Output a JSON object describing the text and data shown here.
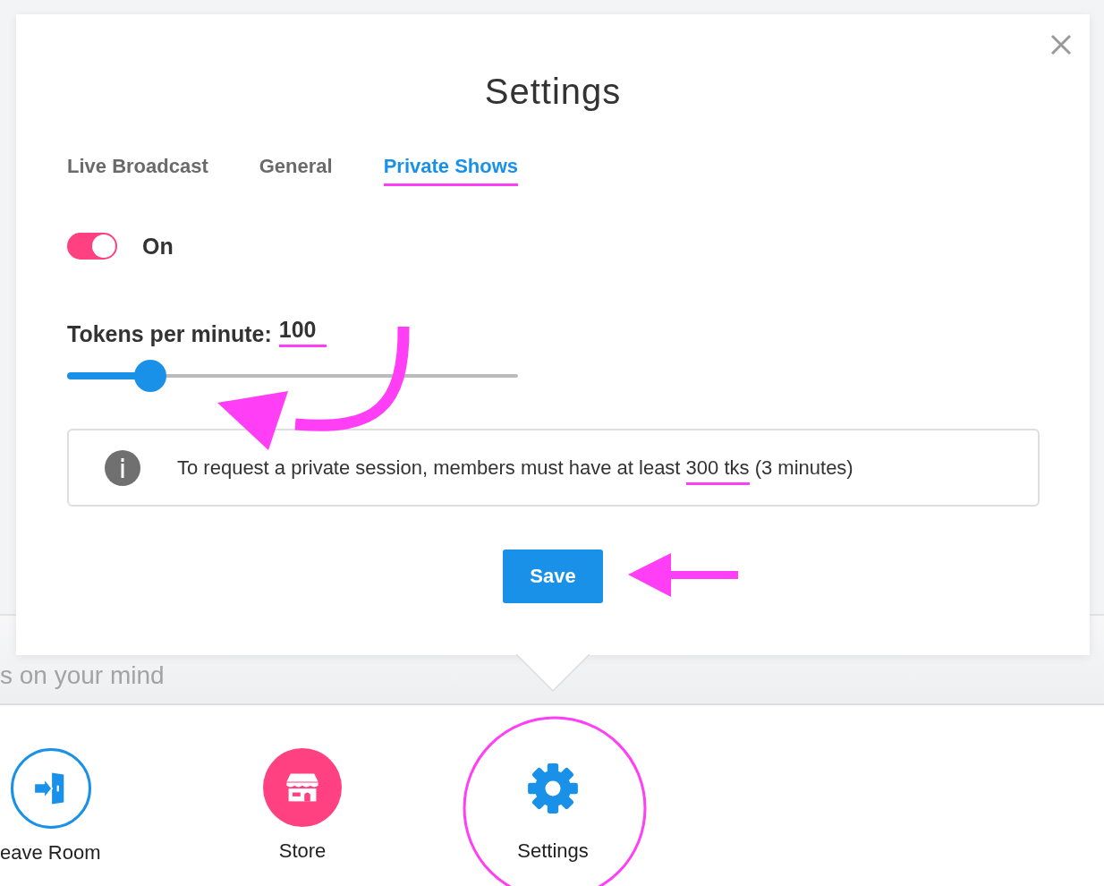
{
  "dialog": {
    "title": "Settings",
    "tabs": [
      {
        "label": "Live Broadcast",
        "selected": false
      },
      {
        "label": "General",
        "selected": false
      },
      {
        "label": "Private Shows",
        "selected": true
      }
    ],
    "toggle": {
      "on": true,
      "label": "On"
    },
    "rate": {
      "label": "Tokens per minute:",
      "value": "100",
      "level": 0.185
    },
    "info": {
      "text_before": "To request a private session, members must have at least ",
      "text_highlight": "300 tks",
      "text_after": " (3 minutes)"
    },
    "save_button": "Save"
  },
  "chat_input": {
    "placeholder": "s on your mind"
  },
  "bottom_bar": [
    {
      "kind": "exit",
      "label": "eave Room"
    },
    {
      "kind": "store",
      "label": "Store"
    },
    {
      "kind": "settings",
      "label": "Settings"
    }
  ]
}
